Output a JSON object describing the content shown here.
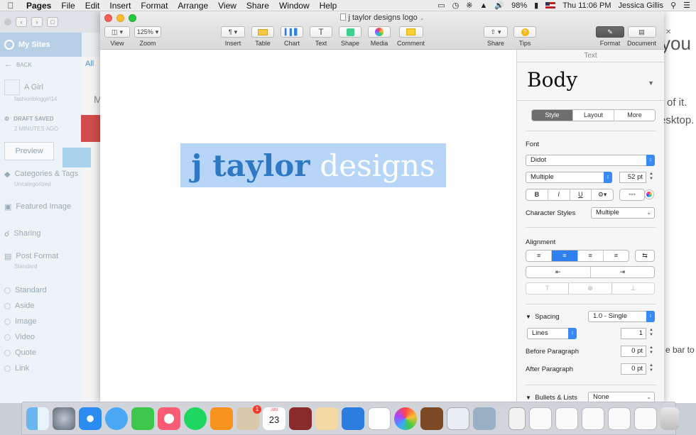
{
  "menubar": {
    "app": "Pages",
    "items": [
      "File",
      "Edit",
      "Insert",
      "Format",
      "Arrange",
      "View",
      "Share",
      "Window",
      "Help"
    ],
    "battery": "98%",
    "datetime": "Thu 11:06 PM",
    "user": "Jessica Gillis"
  },
  "window": {
    "title": "j taylor designs logo",
    "toolbar": {
      "view": "View",
      "zoom": "Zoom",
      "zoom_value": "125%",
      "insert": "Insert",
      "table": "Table",
      "chart": "Chart",
      "text": "Text",
      "shape": "Shape",
      "media": "Media",
      "comment": "Comment",
      "share": "Share",
      "tips": "Tips",
      "format": "Format",
      "document": "Document"
    }
  },
  "canvas": {
    "logo_part1": "j taylor",
    "logo_part2": "designs"
  },
  "inspector": {
    "header": "Text",
    "paragraph_style": "Body",
    "tabs": [
      "Style",
      "Layout",
      "More"
    ],
    "font_label": "Font",
    "font_name": "Didot",
    "typeface": "Multiple",
    "font_size": "52 pt",
    "bold": "B",
    "italic": "I",
    "underline": "U",
    "character_styles_label": "Character Styles",
    "character_styles_value": "Multiple",
    "alignment_label": "Alignment",
    "spacing_label": "Spacing",
    "spacing_value": "1.0 - Single",
    "lines_mode": "Lines",
    "lines_value": "1",
    "before_paragraph_label": "Before Paragraph",
    "before_paragraph_value": "0 pt",
    "after_paragraph_label": "After Paragraph",
    "after_paragraph_value": "0 pt",
    "bullets_label": "Bullets & Lists",
    "bullets_value": "None"
  },
  "background_left": {
    "my_sites": "My Sites",
    "reader": "Read",
    "all": "All",
    "back": "BACK",
    "site_name": "A Girl",
    "site_url": "fashionbloggirl14",
    "draft_saved": "DRAFT SAVED",
    "time_ago": "2 MINUTES AGO",
    "preview": "Preview",
    "categories": "Categories & Tags",
    "uncategorized": "Uncategorized",
    "featured_image": "Featured Image",
    "sharing": "Sharing",
    "post_format": "Post Format",
    "post_format_value": "Standard",
    "formats": [
      "Standard",
      "Aside",
      "Image",
      "Video",
      "Quote",
      "Link"
    ]
  },
  "background_right": {
    "heading_fragment": "you",
    "line1": "of it.",
    "line2": "esktop.",
    "line3": "e bar to c"
  },
  "dock": {
    "badge": "1",
    "calendar_day": "23"
  }
}
